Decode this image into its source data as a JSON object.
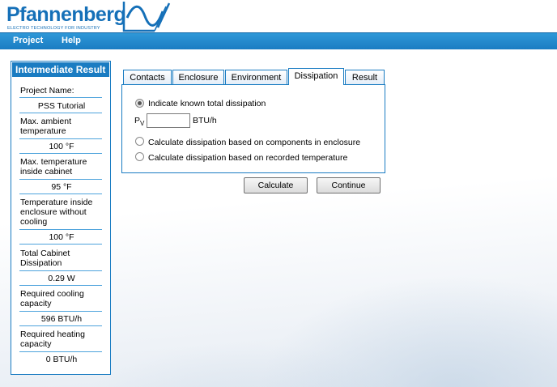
{
  "brand": {
    "name": "Pfannenberg",
    "tagline": "ELECTRO TECHNOLOGY FOR INDUSTRY",
    "color": "#1570b8"
  },
  "menu": {
    "project_label": "Project",
    "help_label": "Help"
  },
  "sidebar": {
    "title": "Intermediate Result",
    "items": [
      {
        "label": "Project Name:",
        "value": "PSS Tutorial"
      },
      {
        "label": "Max. ambient temperature",
        "value": "100 °F"
      },
      {
        "label": "Max. temperature inside cabinet",
        "value": "95 °F"
      },
      {
        "label": "Temperature inside enclosure without cooling",
        "value": "100 °F"
      },
      {
        "label": "Total Cabinet Dissipation",
        "value": "0.29 W"
      },
      {
        "label": "Required cooling capacity",
        "value": "596 BTU/h"
      },
      {
        "label": "Required heating capacity",
        "value": "0 BTU/h"
      }
    ]
  },
  "tabs": {
    "contacts": "Contacts",
    "enclosure": "Enclosure",
    "environment": "Environment",
    "dissipation": "Dissipation",
    "result": "Result",
    "active": "Dissipation"
  },
  "dissipation": {
    "option_known": "Indicate known total dissipation",
    "pv_label": "P",
    "pv_sub": "V",
    "pv_value": "",
    "pv_unit": "BTU/h",
    "option_components": "Calculate dissipation based on components in enclosure",
    "option_recorded": "Calculate dissipation based on recorded temperature",
    "selected": "option_known"
  },
  "buttons": {
    "calculate": "Calculate",
    "continue": "Continue"
  },
  "colors": {
    "accent": "#1a7cc2",
    "menubar": "#2f98d8"
  }
}
